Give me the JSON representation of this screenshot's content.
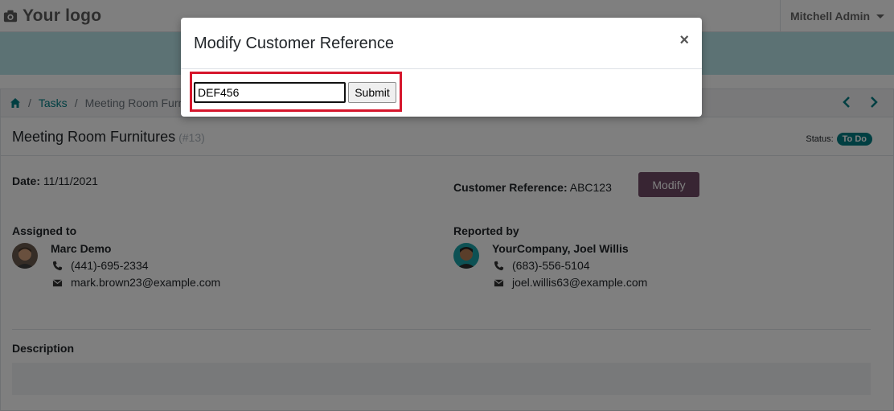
{
  "navbar": {
    "logo_text": "Your logo",
    "user_name": "Mitchell Admin"
  },
  "breadcrumb": {
    "tasks_label": "Tasks",
    "current_label": "Meeting Room Furni"
  },
  "task": {
    "title": "Meeting Room Furnitures",
    "id_label": "(#13)",
    "status_label": "Status:",
    "status_value": "To Do",
    "date_label": "Date:",
    "date_value": "11/11/2021",
    "customer_reference_label": "Customer Reference:",
    "customer_reference_value": "ABC123",
    "modify_label": "Modify",
    "assigned_to_label": "Assigned to",
    "assignee": {
      "name": "Marc Demo",
      "phone": "(441)-695-2334",
      "email": "mark.brown23@example.com"
    },
    "reported_by_label": "Reported by",
    "reporter": {
      "name": "YourCompany, Joel Willis",
      "phone": "(683)-556-5104",
      "email": "joel.willis63@example.com"
    },
    "description_label": "Description"
  },
  "modal": {
    "title": "Modify Customer Reference",
    "close_symbol": "×",
    "input_value": "DEF456",
    "submit_label": "Submit"
  },
  "colors": {
    "accent": "#017e84",
    "primary_button": "#714b67",
    "highlight_border": "#d6162c",
    "banner": "#b8e5e8"
  }
}
